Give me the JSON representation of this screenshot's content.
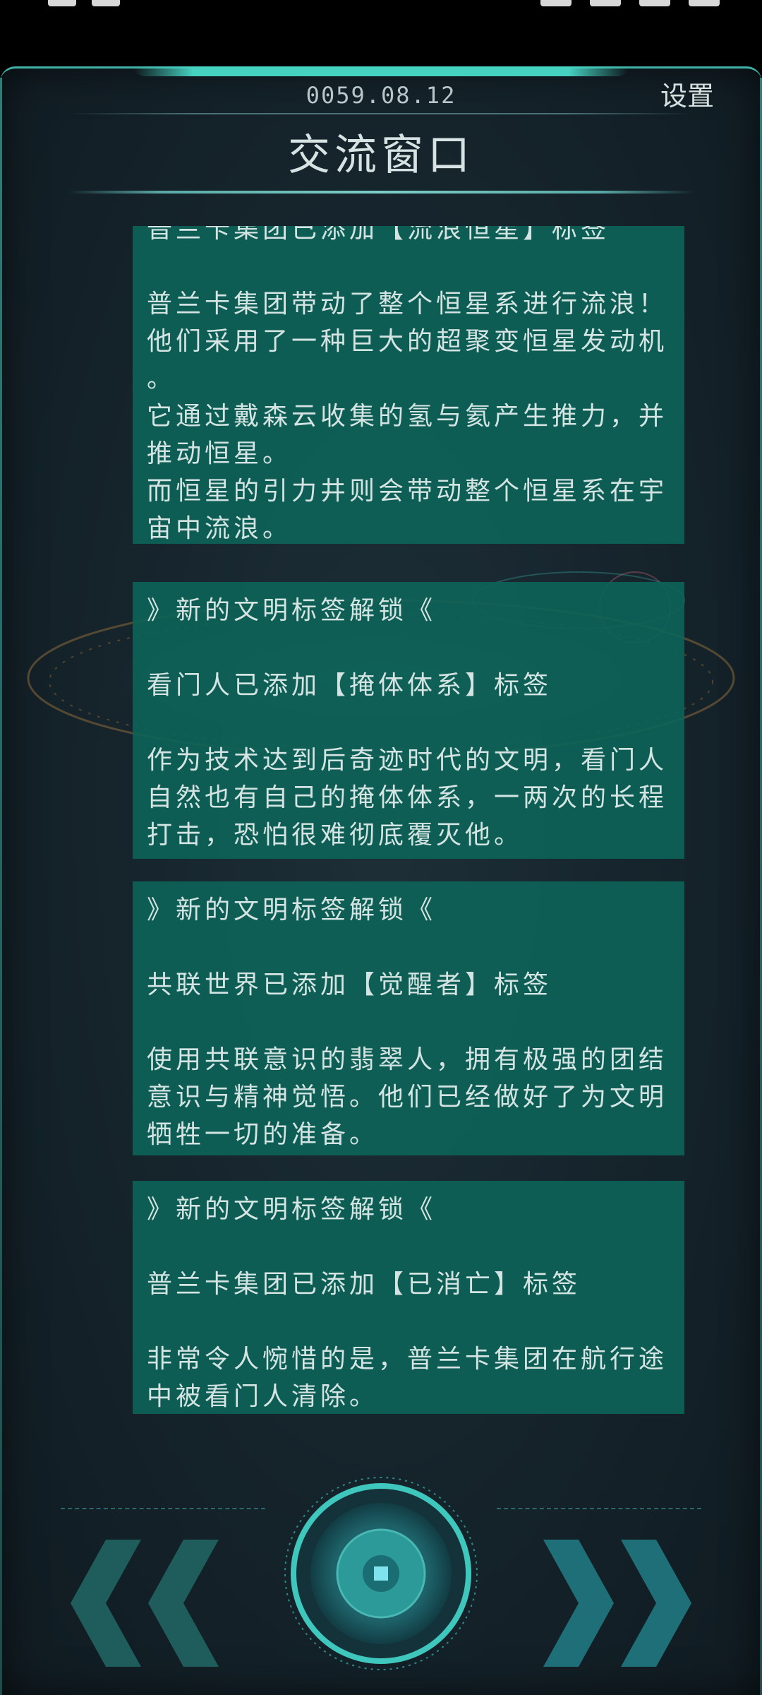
{
  "header": {
    "date": "0059.08.12",
    "settings_label": "设置",
    "title": "交流窗口"
  },
  "messages": [
    {
      "lines": [
        "普兰卡集团已添加【流浪恒星】标签",
        "",
        "普兰卡集团带动了整个恒星系进行流浪！",
        "他们采用了一种巨大的超聚变恒星发动机",
        "。",
        "它通过戴森云收集的氢与氦产生推力，并",
        "推动恒星。",
        "而恒星的引力井则会带动整个恒星系在宇",
        "宙中流浪。"
      ]
    },
    {
      "lines": [
        "》新的文明标签解锁《",
        "",
        "看门人已添加【掩体体系】标签",
        "",
        "作为技术达到后奇迹时代的文明，看门人",
        "自然也有自己的掩体体系，一两次的长程",
        "打击，恐怕很难彻底覆灭他。"
      ]
    },
    {
      "lines": [
        "》新的文明标签解锁《",
        "",
        "共联世界已添加【觉醒者】标签",
        "",
        "使用共联意识的翡翠人，拥有极强的团结",
        "意识与精神觉悟。他们已经做好了为文明",
        "牺牲一切的准备。"
      ]
    },
    {
      "lines": [
        "》新的文明标签解锁《",
        "",
        "普兰卡集团已添加【已消亡】标签",
        "",
        "非常令人惋惜的是，普兰卡集团在航行途",
        "中被看门人清除。"
      ]
    }
  ],
  "colors": {
    "accent": "#3fc7bd",
    "card_bg": "#0e6258",
    "text": "#d4e4e2",
    "bg": "#15232b"
  },
  "icons": {
    "prev": "double-chevron-left-icon",
    "next": "double-chevron-right-icon",
    "center": "target-circle-icon"
  }
}
